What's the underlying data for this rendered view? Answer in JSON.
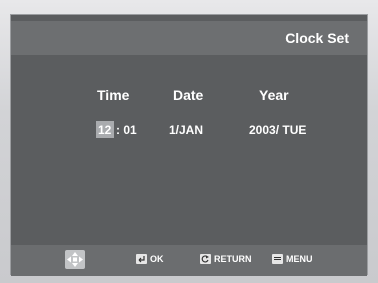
{
  "screen": {
    "title": "Clock Set",
    "columns": {
      "time": "Time",
      "date": "Date",
      "year": "Year"
    },
    "values": {
      "hour": "12",
      "minute_sep": ": 01",
      "date": "1/JAN",
      "year": "2003/ TUE"
    }
  },
  "footer": {
    "nav_icon": "direction-pad-icon",
    "ok": "OK",
    "return": "RETURN",
    "menu": "MENU"
  }
}
